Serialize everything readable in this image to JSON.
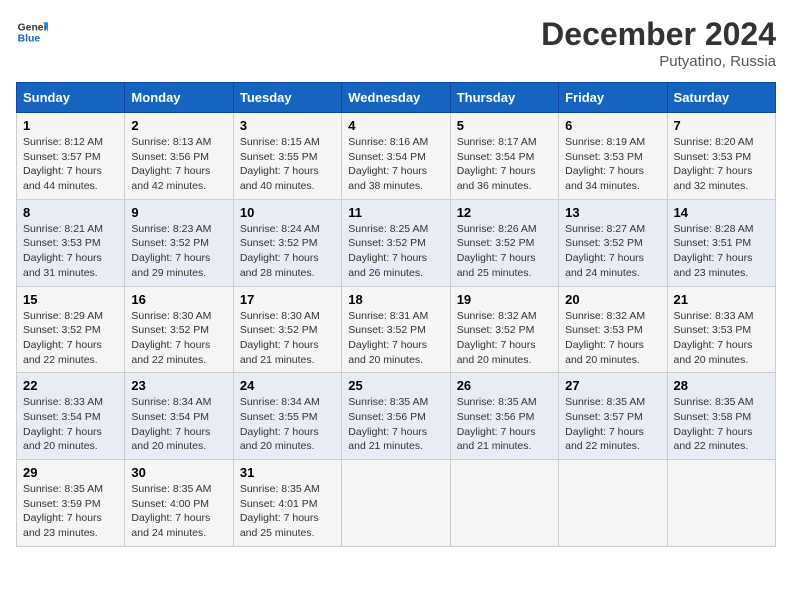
{
  "header": {
    "logo_general": "General",
    "logo_blue": "Blue",
    "month_title": "December 2024",
    "location": "Putyatino, Russia"
  },
  "weekdays": [
    "Sunday",
    "Monday",
    "Tuesday",
    "Wednesday",
    "Thursday",
    "Friday",
    "Saturday"
  ],
  "weeks": [
    [
      {
        "day": "1",
        "sunrise": "Sunrise: 8:12 AM",
        "sunset": "Sunset: 3:57 PM",
        "daylight": "Daylight: 7 hours and 44 minutes."
      },
      {
        "day": "2",
        "sunrise": "Sunrise: 8:13 AM",
        "sunset": "Sunset: 3:56 PM",
        "daylight": "Daylight: 7 hours and 42 minutes."
      },
      {
        "day": "3",
        "sunrise": "Sunrise: 8:15 AM",
        "sunset": "Sunset: 3:55 PM",
        "daylight": "Daylight: 7 hours and 40 minutes."
      },
      {
        "day": "4",
        "sunrise": "Sunrise: 8:16 AM",
        "sunset": "Sunset: 3:54 PM",
        "daylight": "Daylight: 7 hours and 38 minutes."
      },
      {
        "day": "5",
        "sunrise": "Sunrise: 8:17 AM",
        "sunset": "Sunset: 3:54 PM",
        "daylight": "Daylight: 7 hours and 36 minutes."
      },
      {
        "day": "6",
        "sunrise": "Sunrise: 8:19 AM",
        "sunset": "Sunset: 3:53 PM",
        "daylight": "Daylight: 7 hours and 34 minutes."
      },
      {
        "day": "7",
        "sunrise": "Sunrise: 8:20 AM",
        "sunset": "Sunset: 3:53 PM",
        "daylight": "Daylight: 7 hours and 32 minutes."
      }
    ],
    [
      {
        "day": "8",
        "sunrise": "Sunrise: 8:21 AM",
        "sunset": "Sunset: 3:53 PM",
        "daylight": "Daylight: 7 hours and 31 minutes."
      },
      {
        "day": "9",
        "sunrise": "Sunrise: 8:23 AM",
        "sunset": "Sunset: 3:52 PM",
        "daylight": "Daylight: 7 hours and 29 minutes."
      },
      {
        "day": "10",
        "sunrise": "Sunrise: 8:24 AM",
        "sunset": "Sunset: 3:52 PM",
        "daylight": "Daylight: 7 hours and 28 minutes."
      },
      {
        "day": "11",
        "sunrise": "Sunrise: 8:25 AM",
        "sunset": "Sunset: 3:52 PM",
        "daylight": "Daylight: 7 hours and 26 minutes."
      },
      {
        "day": "12",
        "sunrise": "Sunrise: 8:26 AM",
        "sunset": "Sunset: 3:52 PM",
        "daylight": "Daylight: 7 hours and 25 minutes."
      },
      {
        "day": "13",
        "sunrise": "Sunrise: 8:27 AM",
        "sunset": "Sunset: 3:52 PM",
        "daylight": "Daylight: 7 hours and 24 minutes."
      },
      {
        "day": "14",
        "sunrise": "Sunrise: 8:28 AM",
        "sunset": "Sunset: 3:51 PM",
        "daylight": "Daylight: 7 hours and 23 minutes."
      }
    ],
    [
      {
        "day": "15",
        "sunrise": "Sunrise: 8:29 AM",
        "sunset": "Sunset: 3:52 PM",
        "daylight": "Daylight: 7 hours and 22 minutes."
      },
      {
        "day": "16",
        "sunrise": "Sunrise: 8:30 AM",
        "sunset": "Sunset: 3:52 PM",
        "daylight": "Daylight: 7 hours and 22 minutes."
      },
      {
        "day": "17",
        "sunrise": "Sunrise: 8:30 AM",
        "sunset": "Sunset: 3:52 PM",
        "daylight": "Daylight: 7 hours and 21 minutes."
      },
      {
        "day": "18",
        "sunrise": "Sunrise: 8:31 AM",
        "sunset": "Sunset: 3:52 PM",
        "daylight": "Daylight: 7 hours and 20 minutes."
      },
      {
        "day": "19",
        "sunrise": "Sunrise: 8:32 AM",
        "sunset": "Sunset: 3:52 PM",
        "daylight": "Daylight: 7 hours and 20 minutes."
      },
      {
        "day": "20",
        "sunrise": "Sunrise: 8:32 AM",
        "sunset": "Sunset: 3:53 PM",
        "daylight": "Daylight: 7 hours and 20 minutes."
      },
      {
        "day": "21",
        "sunrise": "Sunrise: 8:33 AM",
        "sunset": "Sunset: 3:53 PM",
        "daylight": "Daylight: 7 hours and 20 minutes."
      }
    ],
    [
      {
        "day": "22",
        "sunrise": "Sunrise: 8:33 AM",
        "sunset": "Sunset: 3:54 PM",
        "daylight": "Daylight: 7 hours and 20 minutes."
      },
      {
        "day": "23",
        "sunrise": "Sunrise: 8:34 AM",
        "sunset": "Sunset: 3:54 PM",
        "daylight": "Daylight: 7 hours and 20 minutes."
      },
      {
        "day": "24",
        "sunrise": "Sunrise: 8:34 AM",
        "sunset": "Sunset: 3:55 PM",
        "daylight": "Daylight: 7 hours and 20 minutes."
      },
      {
        "day": "25",
        "sunrise": "Sunrise: 8:35 AM",
        "sunset": "Sunset: 3:56 PM",
        "daylight": "Daylight: 7 hours and 21 minutes."
      },
      {
        "day": "26",
        "sunrise": "Sunrise: 8:35 AM",
        "sunset": "Sunset: 3:56 PM",
        "daylight": "Daylight: 7 hours and 21 minutes."
      },
      {
        "day": "27",
        "sunrise": "Sunrise: 8:35 AM",
        "sunset": "Sunset: 3:57 PM",
        "daylight": "Daylight: 7 hours and 22 minutes."
      },
      {
        "day": "28",
        "sunrise": "Sunrise: 8:35 AM",
        "sunset": "Sunset: 3:58 PM",
        "daylight": "Daylight: 7 hours and 22 minutes."
      }
    ],
    [
      {
        "day": "29",
        "sunrise": "Sunrise: 8:35 AM",
        "sunset": "Sunset: 3:59 PM",
        "daylight": "Daylight: 7 hours and 23 minutes."
      },
      {
        "day": "30",
        "sunrise": "Sunrise: 8:35 AM",
        "sunset": "Sunset: 4:00 PM",
        "daylight": "Daylight: 7 hours and 24 minutes."
      },
      {
        "day": "31",
        "sunrise": "Sunrise: 8:35 AM",
        "sunset": "Sunset: 4:01 PM",
        "daylight": "Daylight: 7 hours and 25 minutes."
      },
      null,
      null,
      null,
      null
    ]
  ]
}
